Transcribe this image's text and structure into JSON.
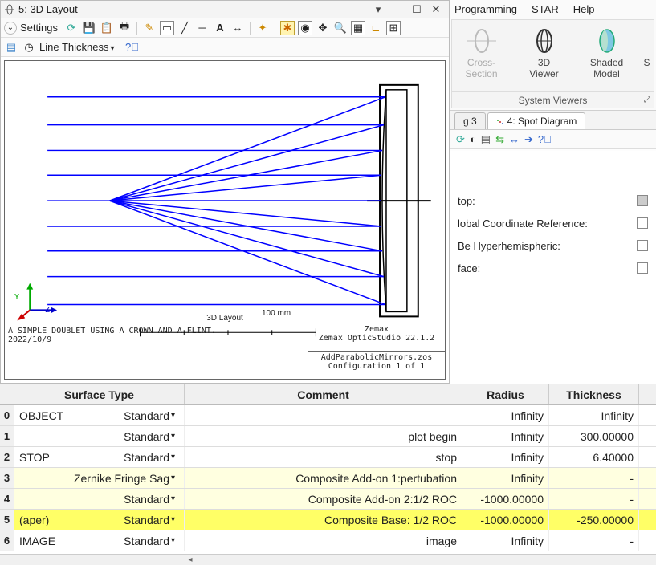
{
  "window": {
    "title": "5: 3D Layout"
  },
  "toolbar": {
    "settings": "Settings",
    "line_thickness": "Line Thickness"
  },
  "menu": {
    "programming": "Programming",
    "star": "STAR",
    "help": "Help"
  },
  "ribbon": {
    "group_title": "System Viewers",
    "cross_section": "Cross-Section",
    "viewer3d_l1": "3D",
    "viewer3d_l2": "Viewer",
    "shaded_l1": "Shaded",
    "shaded_l2": "Model",
    "extra": "S"
  },
  "tabs": {
    "tab_g3": "g 3",
    "tab_spot": "4: Spot Diagram"
  },
  "props": {
    "stop": "top:",
    "global_ref": "lobal Coordinate Reference:",
    "hyperhemi": "Be Hyperhemispheric:",
    "face": "face:"
  },
  "plot": {
    "caption": "3D Layout",
    "scale_label": "100 mm",
    "desc_line1": "A SIMPLE DOUBLET USING A CROWN AND A FLINT.",
    "desc_line2": "2022/10/9",
    "brand_l1": "Zemax",
    "brand_l2": "Zemax OpticStudio 22.1.2",
    "file_l1": "AddParabolicMirrors.zos",
    "file_l2": "Configuration 1 of 1",
    "axis_y": "Y",
    "axis_z": "Z"
  },
  "table": {
    "headers": {
      "stype": "Surface Type",
      "comment": "Comment",
      "radius": "Radius",
      "thickness": "Thickness"
    },
    "rows": [
      {
        "idx": "0",
        "name": "OBJECT",
        "type": "Standard",
        "comment": "",
        "radius": "Infinity",
        "thickness": "Infinity"
      },
      {
        "idx": "1",
        "name": "",
        "type": "Standard",
        "comment": "plot begin",
        "radius": "Infinity",
        "thickness": "300.00000"
      },
      {
        "idx": "2",
        "name": "STOP",
        "type": "Standard",
        "comment": "stop",
        "radius": "Infinity",
        "thickness": "6.40000"
      },
      {
        "idx": "3",
        "name": "",
        "type": "Zernike Fringe Sag",
        "comment": "Composite Add-on 1:pertubation",
        "radius": "Infinity",
        "thickness": "-"
      },
      {
        "idx": "4",
        "name": "",
        "type": "Standard",
        "comment": "Composite Add-on 2:1/2 ROC",
        "radius": "-1000.00000",
        "thickness": "-"
      },
      {
        "idx": "5",
        "name": "(aper)",
        "type": "Standard",
        "comment": "Composite Base: 1/2 ROC",
        "radius": "-1000.00000",
        "thickness": "-250.00000"
      },
      {
        "idx": "6",
        "name": "IMAGE",
        "type": "Standard",
        "comment": "image",
        "radius": "Infinity",
        "thickness": "-"
      }
    ]
  }
}
